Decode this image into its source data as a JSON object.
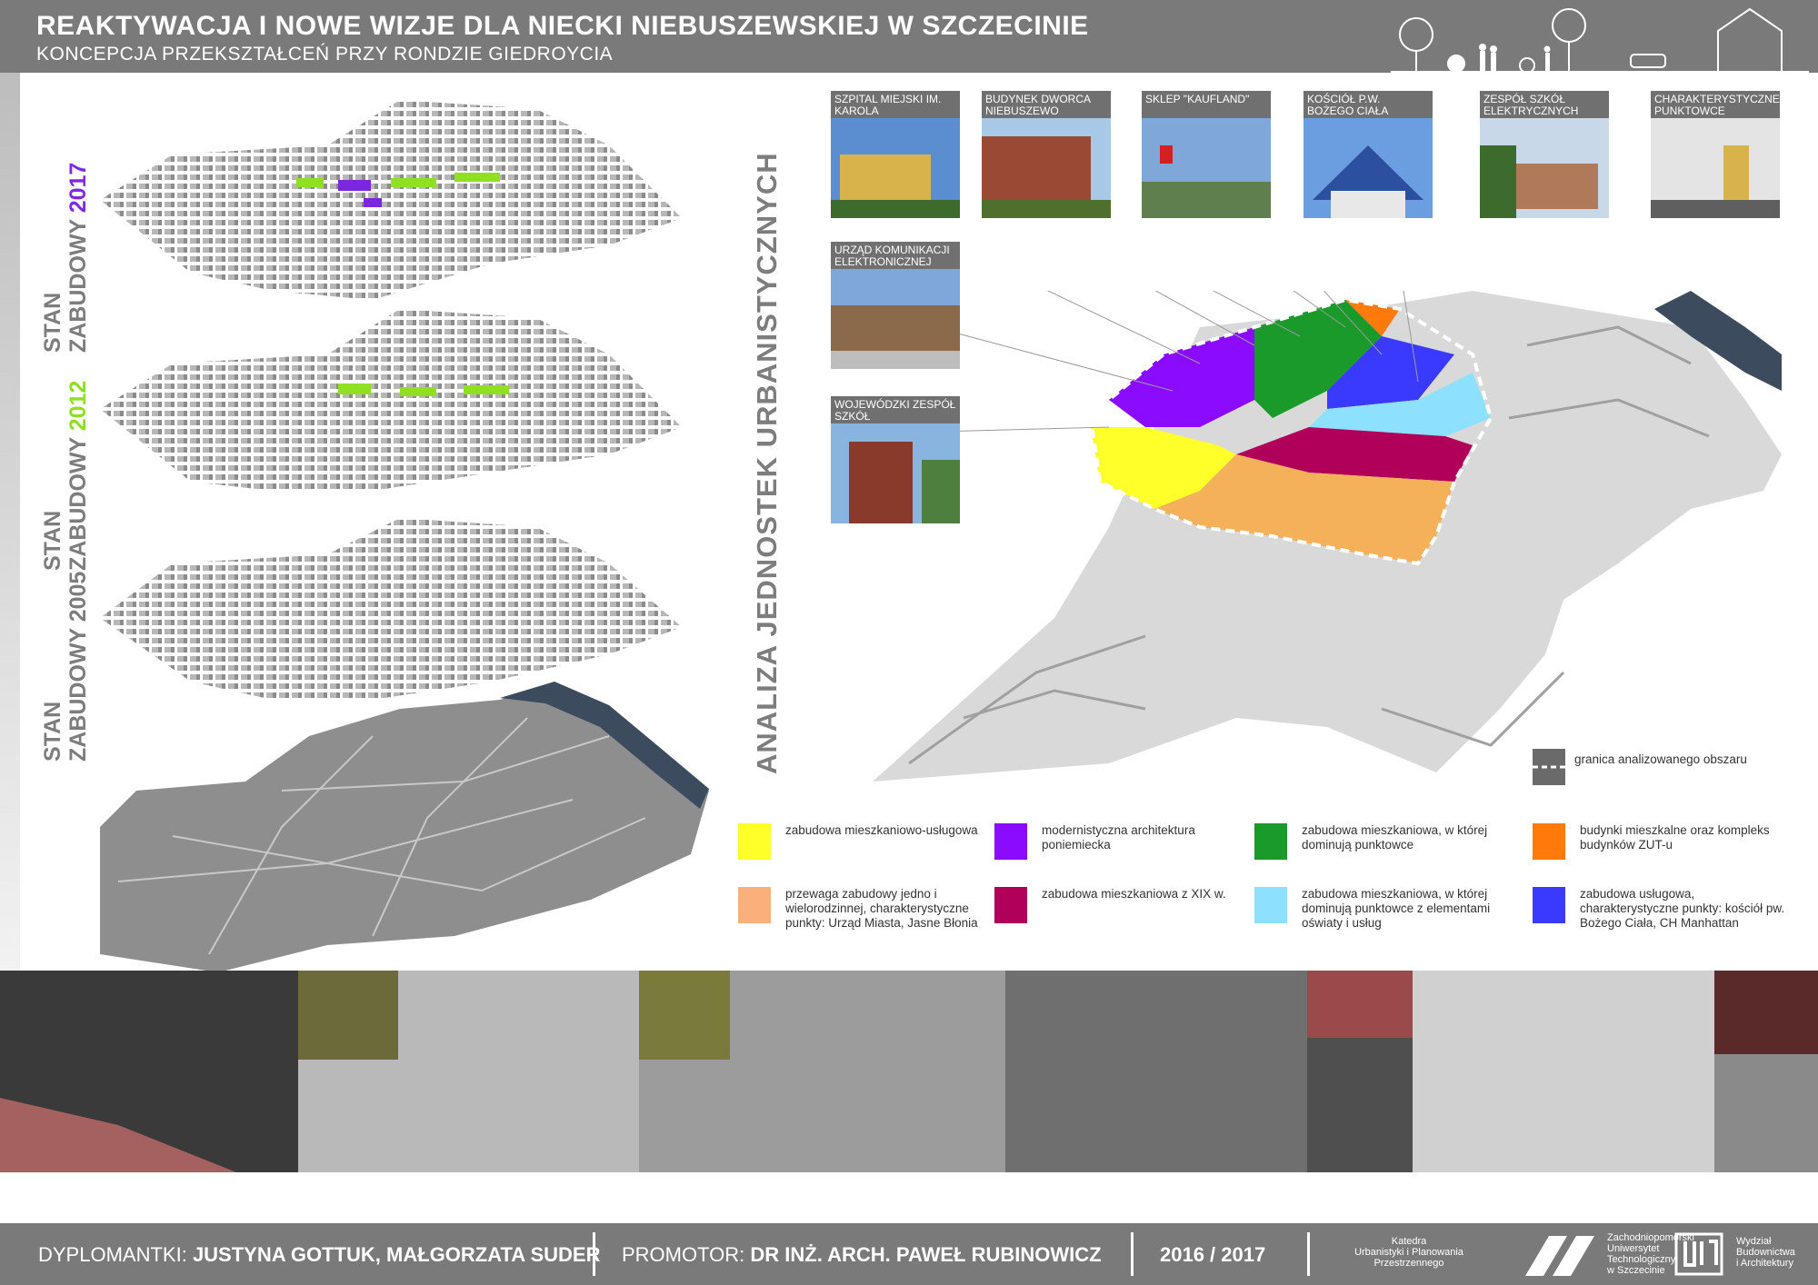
{
  "header": {
    "title": "REAKTYWACJA I NOWE WIZJE DLA NIECKI NIEBUSZEWSKIEJ W SZCZECINIE",
    "subtitle": "KONCEPCJA PRZEKSZTAŁCEŃ PRZY RONDZIE GIEDROYCIA"
  },
  "stages": [
    {
      "line1": "STAN",
      "line2": "ZABUDOWY",
      "year": "2017",
      "year_color": "#7f2ae0"
    },
    {
      "line1": "STAN",
      "line2": "ZABUDOWY",
      "year": "2012",
      "year_color": "#8fe020"
    },
    {
      "line1": "STAN",
      "line2": "ZABUDOWY",
      "year": "2005",
      "year_color": "#7d7d7d"
    }
  ],
  "analysis_title": "ANALIZA JEDNOSTEK URBANISTYCZNYCH",
  "photo_cards": [
    {
      "label": "SZPITAL MIEJSKI IM. KAROLA BOROMEUSZA"
    },
    {
      "label": "BUDYNEK DWORCA NIEBUSZEWO"
    },
    {
      "label": "SKLEP \"KAUFLAND\""
    },
    {
      "label": "KOŚCIÓŁ P.W. BOŻEGO CIAŁA"
    },
    {
      "label": "ZESPÓŁ SZKÓŁ ELEKTRYCZNYCH"
    },
    {
      "label": "CHARAKTERYSTYCZNE PUNKTOWCE"
    },
    {
      "label": "URZĄD KOMUNIKACJI ELEKTRONICZNEJ"
    },
    {
      "label": "WOJEWÓDZKI ZESPÓŁ SZKÓŁ POLICEALNYCH"
    }
  ],
  "legend": [
    {
      "color": "#ffff2a",
      "text": "zabudowa mieszkaniowo-usługowa"
    },
    {
      "color": "#8a0bff",
      "text": "modernistyczna architektura poniemiecka"
    },
    {
      "color": "#1a9a2a",
      "text": "zabudowa mieszkaniowa, w której dominują punktowce"
    },
    {
      "color": "#ff7a0a",
      "text": "budynki mieszkalne oraz kompleks budynków ZUT-u"
    },
    {
      "color": "#f9b07a",
      "text": "przewaga zabudowy jedno i wielorodzinnej, charakterystyczne punkty: Urząd Miasta, Jasne Błonia"
    },
    {
      "color": "#b0005a",
      "text": "zabudowa mieszkaniowa z XIX w."
    },
    {
      "color": "#8ee0ff",
      "text": "zabudowa mieszkaniowa, w której dominują punktowce z elementami oświaty i usług"
    },
    {
      "color": "#3a3aff",
      "text": "zabudowa usługowa, charakterystyczne punkty: kościół pw. Bożego Ciała, CH Manhattan"
    }
  ],
  "boundary_legend": "granica analizowanego obszaru",
  "footer": {
    "authors_label": "DYPLOMANTKI:",
    "authors": "JUSTYNA GOTTUK, MAŁGORZATA SUDER",
    "promotor_label": "PROMOTOR:",
    "promotor": "DR INŻ. ARCH. PAWEŁ RUBINOWICZ",
    "years": "2016 / 2017",
    "dept": [
      "Katedra",
      "Urbanistyki i Planowania",
      "Przestrzennego"
    ],
    "university": [
      "Zachodniopomorski",
      "Uniwersytet",
      "Technologiczny",
      "w Szczecinie"
    ],
    "faculty": [
      "Wydział",
      "Budownictwa",
      "i Architektury"
    ]
  }
}
